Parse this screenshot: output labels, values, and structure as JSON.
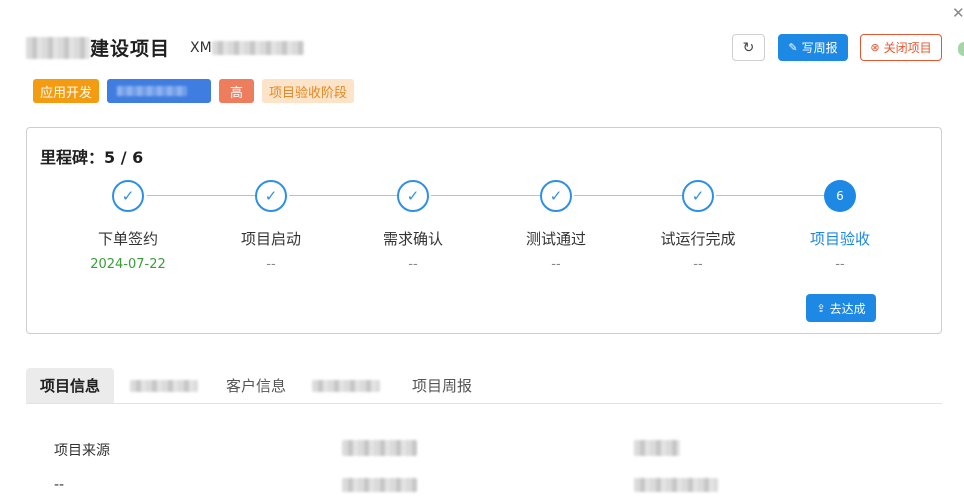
{
  "header": {
    "title": "建设项目",
    "code_prefix": "XM",
    "refresh_icon": "refresh-icon",
    "report_button": "写周报",
    "close_button": "关闭项目"
  },
  "tags": {
    "type": "应用开发",
    "priority": "高",
    "stage": "项目验收阶段"
  },
  "milestones": {
    "label": "里程碑：",
    "progress": "5 / 6",
    "steps": [
      {
        "label": "下单签约",
        "date": "2024-07-22",
        "status": "done"
      },
      {
        "label": "项目启动",
        "date": "--",
        "status": "done"
      },
      {
        "label": "需求确认",
        "date": "--",
        "status": "done"
      },
      {
        "label": "测试通过",
        "date": "--",
        "status": "done"
      },
      {
        "label": "试运行完成",
        "date": "--",
        "status": "done"
      },
      {
        "label": "项目验收",
        "date": "--",
        "status": "current",
        "number": "6"
      }
    ],
    "reach_button": "去达成"
  },
  "tabs": {
    "project_info": "项目信息",
    "customer_info": "客户信息",
    "weekly_report": "项目周报"
  },
  "info": {
    "source_label": "项目来源",
    "source_value": "--"
  },
  "colors": {
    "primary": "#1e88e5",
    "danger": "#e4572e",
    "app_tag": "#f39c12",
    "high_tag": "#ee7d5e",
    "stage_tag_bg": "#fde3c8",
    "stage_tag_text": "#e28a27",
    "success_date": "#3a9d3a"
  }
}
